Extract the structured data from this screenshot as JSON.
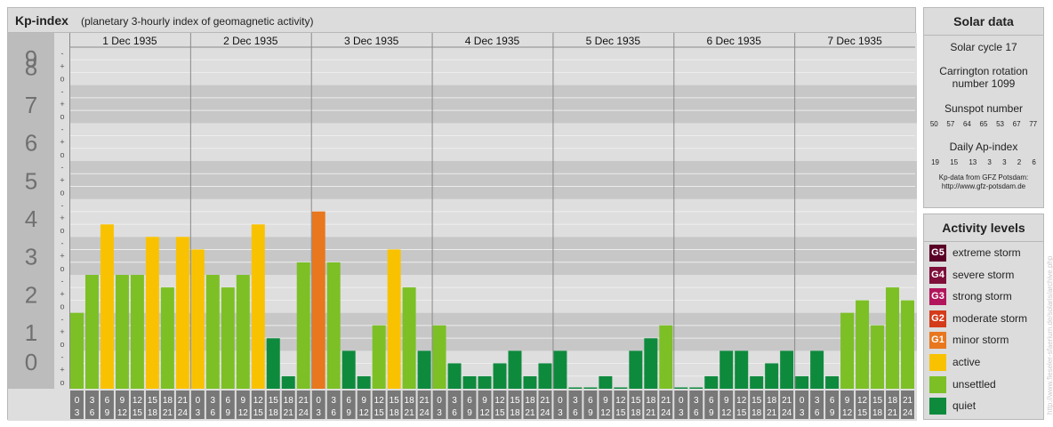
{
  "header": {
    "title": "Kp-index",
    "subtitle": "(planetary 3-hourly index of geomagnetic activity)"
  },
  "chart_data": {
    "type": "bar",
    "title": "Kp-index",
    "subtitle": "(planetary 3-hourly index of geomagnetic activity)",
    "ylim": [
      0,
      9
    ],
    "y_ticks": [
      "0",
      "1",
      "2",
      "3",
      "4",
      "5",
      "6",
      "7",
      "8",
      "9"
    ],
    "sub_tick_marks": [
      "o",
      "+",
      "-"
    ],
    "days": [
      "1 Dec 1935",
      "2 Dec 1935",
      "3 Dec 1935",
      "4 Dec 1935",
      "5 Dec 1935",
      "6 Dec 1935",
      "7 Dec 1935"
    ],
    "slot_labels_top": [
      "0",
      "3",
      "6",
      "9",
      "12",
      "15",
      "18",
      "21"
    ],
    "slot_labels_bottom": [
      "3",
      "6",
      "9",
      "12",
      "15",
      "18",
      "21",
      "24"
    ],
    "values": [
      2.0,
      3.0,
      4.33,
      3.0,
      3.0,
      4.0,
      2.67,
      4.0,
      3.67,
      3.0,
      2.67,
      3.0,
      4.33,
      1.33,
      0.33,
      3.33,
      4.67,
      3.33,
      1.0,
      0.33,
      1.67,
      3.67,
      2.67,
      1.0,
      1.67,
      0.67,
      0.33,
      0.33,
      0.67,
      1.0,
      0.33,
      0.67,
      1.0,
      0.0,
      0.0,
      0.33,
      0.0,
      1.0,
      1.33,
      1.67,
      0.0,
      0.0,
      0.33,
      1.0,
      1.0,
      0.33,
      0.67,
      1.0,
      0.33,
      1.0,
      0.33,
      2.0,
      2.33,
      1.67,
      2.67,
      2.33
    ],
    "colors": {
      "quiet": "#0e8a3d",
      "unsettled": "#7cc025",
      "active": "#f9c200",
      "minor_storm": "#e8771e",
      "bar_outline": "#ffffff",
      "band_dark": "#c7c7c7",
      "band_light": "#dedede",
      "axis_label_bg": "#bcbcbc",
      "time_label_bg": "#787878"
    },
    "grid": true
  },
  "solar": {
    "title": "Solar data",
    "cycle": "Solar cycle 17",
    "carrington_1": "Carrington rotation",
    "carrington_2": "number 1099",
    "sunspot_title": "Sunspot number",
    "sunspot_values": [
      "50",
      "57",
      "64",
      "65",
      "53",
      "67",
      "77"
    ],
    "ap_title": "Daily Ap-index",
    "ap_values": [
      "19",
      "15",
      "13",
      "3",
      "3",
      "2",
      "6"
    ],
    "source_1": "Kp-data from GFZ Potsdam:",
    "source_2": "http://www.gfz-potsdam.de"
  },
  "activity": {
    "title": "Activity levels",
    "levels": [
      {
        "badge": "G5",
        "label": "extreme storm",
        "color": "#5a0026"
      },
      {
        "badge": "G4",
        "label": "severe storm",
        "color": "#7e0f3a"
      },
      {
        "badge": "G3",
        "label": "strong storm",
        "color": "#b2155c"
      },
      {
        "badge": "G2",
        "label": "moderate storm",
        "color": "#d43b1a"
      },
      {
        "badge": "G1",
        "label": "minor storm",
        "color": "#e8771e"
      },
      {
        "badge": "",
        "label": "active",
        "color": "#f9c200"
      },
      {
        "badge": "",
        "label": "unsettled",
        "color": "#7cc025"
      },
      {
        "badge": "",
        "label": "quiet",
        "color": "#0e8a3d"
      }
    ]
  },
  "watermark": "http://www.fieseler-sfaerium.de/solaris/archive.php"
}
